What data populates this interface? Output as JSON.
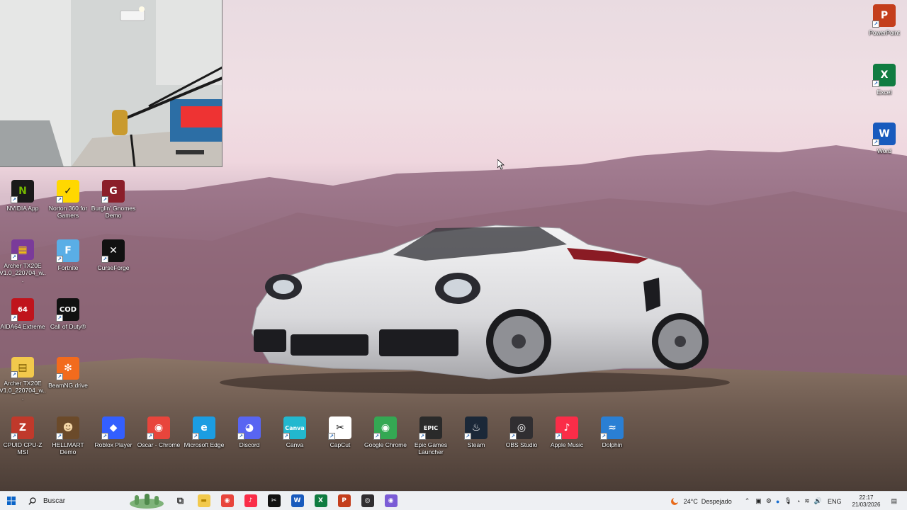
{
  "desktop": {
    "icons_left": [
      {
        "label": "NVIDIA App",
        "glyph": "N",
        "bg": "#1a1a1a",
        "fg": "#76b900"
      },
      {
        "label": "Norton 360 for Gamers",
        "glyph": "✓",
        "bg": "#ffd800",
        "fg": "#1a1a1a"
      },
      {
        "label": "Burglin' Gnomes Demo",
        "glyph": "G",
        "bg": "#8b1e2a",
        "fg": "#fff"
      },
      {
        "label": "Archer TX20E V1.0_220704_w...",
        "glyph": "▦",
        "bg": "#7a3b9a",
        "fg": "#ffd000"
      },
      {
        "label": "Fortnite",
        "glyph": "F",
        "bg": "#5aaee6",
        "fg": "#fff"
      },
      {
        "label": "CurseForge",
        "glyph": "✕",
        "bg": "#111",
        "fg": "#fff"
      },
      {
        "label": "AIDA64 Extreme",
        "glyph": "64",
        "bg": "#c0141c",
        "fg": "#fff"
      },
      {
        "label": "Call of Duty®",
        "glyph": "COD",
        "bg": "#111",
        "fg": "#fff"
      },
      {
        "label": "Archer TX20E V1.0_220704_w...",
        "glyph": "▤",
        "bg": "#f2c94c",
        "fg": "#7a5a00"
      },
      {
        "label": "BeamNG.drive",
        "glyph": "✻",
        "bg": "#f26b1d",
        "fg": "#fff"
      }
    ],
    "icons_bottom": [
      {
        "label": "CPUID CPU-Z MSI",
        "glyph": "Z",
        "bg": "#c0392b",
        "fg": "#fff"
      },
      {
        "label": "HELLMART Demo",
        "glyph": "☻",
        "bg": "#6b4a2a",
        "fg": "#f3d5a5"
      },
      {
        "label": "Roblox Player",
        "glyph": "◆",
        "bg": "#335fff",
        "fg": "#fff"
      },
      {
        "label": "Oscar - Chrome",
        "glyph": "◉",
        "bg": "#e8453c",
        "fg": "#fff"
      },
      {
        "label": "Microsoft Edge",
        "glyph": "e",
        "bg": "#1b9de2",
        "fg": "#fff"
      },
      {
        "label": "Discord",
        "glyph": "◕",
        "bg": "#5865f2",
        "fg": "#fff"
      },
      {
        "label": "Canva",
        "glyph": "Canva",
        "bg": "#22b8cf",
        "fg": "#fff"
      },
      {
        "label": "CapCut",
        "glyph": "✂",
        "bg": "#fff",
        "fg": "#111"
      },
      {
        "label": "Google Chrome",
        "glyph": "◉",
        "bg": "#34a853",
        "fg": "#fff"
      },
      {
        "label": "Epic Games Launcher",
        "glyph": "EPIC",
        "bg": "#2a2a2a",
        "fg": "#fff"
      },
      {
        "label": "Steam",
        "glyph": "♨",
        "bg": "#1b2838",
        "fg": "#fff"
      },
      {
        "label": "OBS Studio",
        "glyph": "◎",
        "bg": "#302e31",
        "fg": "#fff"
      },
      {
        "label": "Apple Music",
        "glyph": "♪",
        "bg": "#fa2d48",
        "fg": "#fff"
      },
      {
        "label": "Dolphin",
        "glyph": "≈",
        "bg": "#2a7fd4",
        "fg": "#fff"
      }
    ],
    "icons_right": [
      {
        "label": "PowerPoint",
        "glyph": "P",
        "bg": "#c43e1c",
        "fg": "#fff"
      },
      {
        "label": "Excel",
        "glyph": "X",
        "bg": "#107c41",
        "fg": "#fff"
      },
      {
        "label": "Word",
        "glyph": "W",
        "bg": "#185abd",
        "fg": "#fff"
      }
    ]
  },
  "taskbar": {
    "search_placeholder": "Buscar",
    "pinned": [
      {
        "name": "task-view",
        "glyph": "⧉",
        "bg": "transparent",
        "fg": "#333"
      },
      {
        "name": "file-explorer",
        "glyph": "▬",
        "bg": "#f2c94c",
        "fg": "#b38300"
      },
      {
        "name": "chrome",
        "glyph": "◉",
        "bg": "#e8453c",
        "fg": "#fff"
      },
      {
        "name": "apple-music",
        "glyph": "♪",
        "bg": "#fa2d48",
        "fg": "#fff"
      },
      {
        "name": "capcut",
        "glyph": "✂",
        "bg": "#111",
        "fg": "#fff"
      },
      {
        "name": "word",
        "glyph": "W",
        "bg": "#185abd",
        "fg": "#fff"
      },
      {
        "name": "excel",
        "glyph": "X",
        "bg": "#107c41",
        "fg": "#fff"
      },
      {
        "name": "powerpoint",
        "glyph": "P",
        "bg": "#c43e1c",
        "fg": "#fff"
      },
      {
        "name": "obs-studio",
        "glyph": "◎",
        "bg": "#302e31",
        "fg": "#fff"
      },
      {
        "name": "oscar-chrome",
        "glyph": "◉",
        "bg": "#7b5cd6",
        "fg": "#fff"
      }
    ],
    "weather": {
      "temp": "24°C",
      "condition": "Despejado"
    },
    "language": "ENG",
    "time": "22:17",
    "date": "21/03/2026"
  }
}
